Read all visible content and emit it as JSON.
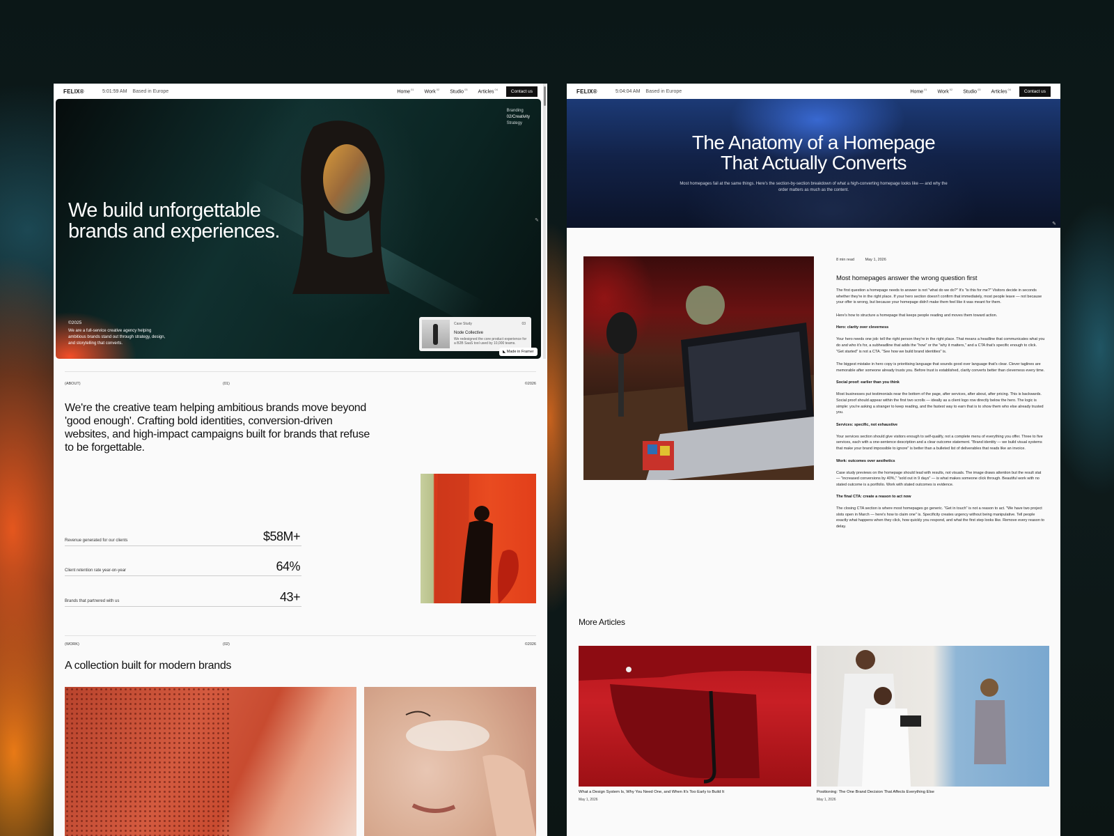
{
  "left_page": {
    "nav": {
      "logo": "FELIX®",
      "time": "5:01:59 AM",
      "location": "Based in Europe",
      "items": [
        {
          "label": "Home",
          "sup": "01"
        },
        {
          "label": "Work",
          "sup": "02"
        },
        {
          "label": "Studio",
          "sup": "03"
        },
        {
          "label": "Articles",
          "sup": "04"
        }
      ],
      "contact": "Contact us"
    },
    "hero": {
      "title_line1": "We build unforgettable",
      "title_line2": "brands and experiences.",
      "menu": [
        "Branding",
        "02/Creativity",
        "Strategy"
      ],
      "year": "©2025",
      "description": "We are a full-service creative agency helping ambitious brands stand out through strategy, design, and storytelling that converts.",
      "case_study": {
        "label": "Case Study",
        "number": "03",
        "client": "Node Collective",
        "text": "We redesigned the core product experience for a B2B SaaS tool used by 10,000 teams."
      },
      "badge": "Made in Framer"
    },
    "about": {
      "tag": "(ABOUT)",
      "num": "(01)",
      "year": "©2026",
      "text": "We're the creative team helping ambitious brands move beyond 'good enough'. Crafting bold identities, conversion-driven websites, and high-impact campaigns built for brands that refuse to be forgettable.",
      "stats": [
        {
          "label": "Revenue generated for our clients",
          "value": "$58M+"
        },
        {
          "label": "Client retention rate year-on-year",
          "value": "64%"
        },
        {
          "label": "Brands that partnered with us",
          "value": "43+"
        }
      ]
    },
    "work": {
      "tag": "(WORK)",
      "num": "(02)",
      "year": "©2026",
      "title": "A collection built for modern brands"
    }
  },
  "right_page": {
    "nav": {
      "logo": "FELIX®",
      "time": "5:04:04 AM",
      "location": "Based in Europe",
      "items": [
        {
          "label": "Home",
          "sup": "01"
        },
        {
          "label": "Work",
          "sup": "02"
        },
        {
          "label": "Studio",
          "sup": "03"
        },
        {
          "label": "Articles",
          "sup": "04"
        }
      ],
      "contact": "Contact us"
    },
    "article": {
      "title_line1": "The Anatomy of a Homepage",
      "title_line2": "That Actually Converts",
      "subtitle": "Most homepages fail at the same things. Here's the section-by-section breakdown of what a high-converting homepage looks like — and why the order matters as much as the content.",
      "read_time": "8 min read",
      "date": "May 1, 2026",
      "heading": "Most homepages answer the wrong question first",
      "p1": "The first question a homepage needs to answer is not \"what do we do?\" It's \"is this for me?\" Visitors decide in seconds whether they're in the right place. If your hero section doesn't confirm that immediately, most people leave — not because your offer is wrong, but because your homepage didn't make them feel like it was meant for them.",
      "p2": "Here's how to structure a homepage that keeps people reading and moves them toward action.",
      "h_hero": "Hero: clarity over cleverness",
      "p3": "Your hero needs one job: tell the right person they're in the right place. That means a headline that communicates what you do and who it's for, a subheadline that adds the \"how\" or the \"why it matters,\" and a CTA that's specific enough to click. \"Get started\" is not a CTA. \"See how we build brand identities\" is.",
      "p4": "The biggest mistake in hero copy is prioritising language that sounds good over language that's clear. Clever taglines are memorable after someone already trusts you. Before trust is established, clarity converts better than cleverness every time.",
      "h_social": "Social proof: earlier than you think",
      "p5": "Most businesses put testimonials near the bottom of the page, after services, after about, after pricing. This is backwards. Social proof should appear within the first two scrolls — ideally as a client logo row directly below the hero. The logic is simple: you're asking a stranger to keep reading, and the fastest way to earn that is to show them who else already trusted you.",
      "h_services": "Services: specific, not exhaustive",
      "p6": "Your services section should give visitors enough to self-qualify, not a complete menu of everything you offer. Three to five services, each with a one-sentence description and a clear outcome statement. \"Brand identity — we build visual systems that make your brand impossible to ignore\" is better than a bulleted list of deliverables that reads like an invoice.",
      "h_work": "Work: outcomes over aesthetics",
      "p7": "Case study previews on the homepage should lead with results, not visuals. The image draws attention but the result stat — \"increased conversions by 40%,\" \"sold out in 9 days\" — is what makes someone click through. Beautiful work with no stated outcome is a portfolio. Work with stated outcomes is evidence.",
      "h_cta": "The final CTA: create a reason to act now",
      "p8": "The closing CTA section is where most homepages go generic. \"Get in touch\" is not a reason to act. \"We have two project slots open in March — here's how to claim one\" is. Specificity creates urgency without being manipulative. Tell people exactly what happens when they click, how quickly you respond, and what the first step looks like. Remove every reason to delay."
    },
    "more": {
      "title": "More Articles",
      "cards": [
        {
          "title": "What a Design System Is, Why You Need One, and When It's Too Early to Build It",
          "date": "May 1, 2026"
        },
        {
          "title": "Positioning: The One Brand Decision That Affects Everything Else",
          "date": "May 1, 2026"
        }
      ]
    }
  }
}
